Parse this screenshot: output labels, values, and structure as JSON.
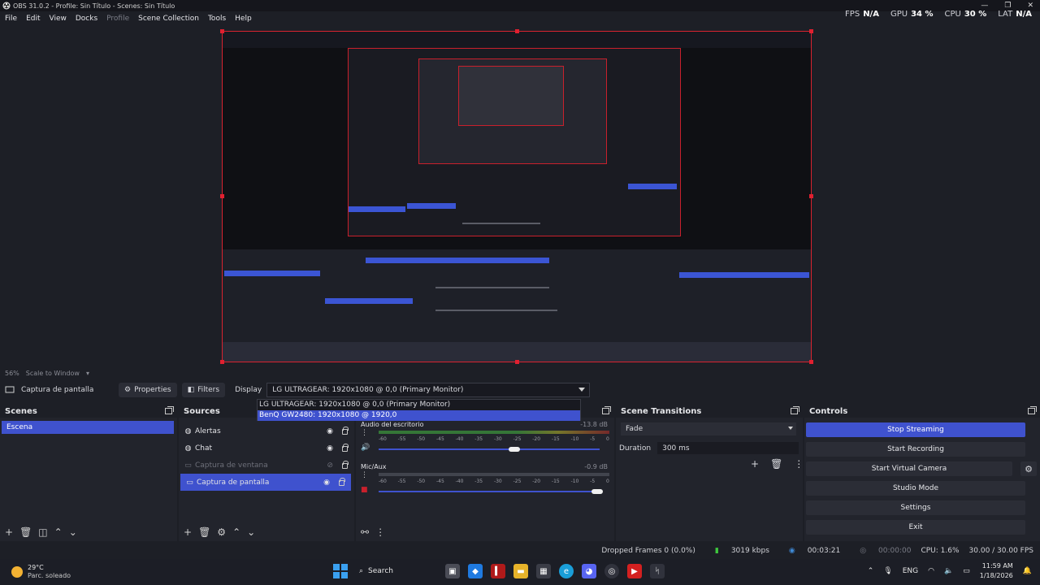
{
  "window": {
    "title": "OBS 31.0.2 - Profile: Sin Título - Scenes: Sin Título",
    "controls": [
      "—",
      "❐",
      "✕"
    ]
  },
  "menu": [
    "File",
    "Edit",
    "View",
    "Docks",
    "Profile",
    "Scene Collection",
    "Tools",
    "Help"
  ],
  "stats": {
    "fps_label": "FPS",
    "fps_value": "N/A",
    "gpu_label": "GPU",
    "gpu_value": "34 %",
    "cpu_label": "CPU",
    "cpu_value": "30 %",
    "lat_label": "LAT",
    "lat_value": "N/A"
  },
  "preview": {
    "zoom": "56%",
    "scale_mode": "Scale to Window"
  },
  "source_toolbar": {
    "source_name": "Captura de pantalla",
    "properties_label": "Properties",
    "filters_label": "Filters",
    "display_label": "Display",
    "display_value": "LG ULTRAGEAR: 1920x1080 @ 0,0 (Primary Monitor)"
  },
  "display_dropdown": {
    "options": [
      "LG ULTRAGEAR: 1920x1080 @ 0,0 (Primary Monitor)",
      "BenQ GW2480: 1920x1080 @ 1920,0"
    ],
    "highlighted_index": 1
  },
  "scenes": {
    "title": "Scenes",
    "items": [
      "Escena"
    ]
  },
  "sources": {
    "title": "Sources",
    "items": [
      {
        "name": "Alertas",
        "icon": "globe-icon"
      },
      {
        "name": "Chat",
        "icon": "globe-icon"
      },
      {
        "name": "Captura de ventana",
        "icon": "window-icon",
        "hidden": true
      },
      {
        "name": "Captura de pantalla",
        "icon": "monitor-icon",
        "selected": true
      }
    ]
  },
  "mixer": {
    "tracks": [
      {
        "name": "Audio del escritorio",
        "db": "-13.8 dB"
      },
      {
        "name": "Mic/Aux",
        "db": "-0.9 dB"
      }
    ],
    "ticks": [
      "-60",
      "-55",
      "-50",
      "-45",
      "-40",
      "-35",
      "-30",
      "-25",
      "-20",
      "-15",
      "-10",
      "-5",
      "0"
    ]
  },
  "transitions": {
    "title": "Scene Transitions",
    "selected": "Fade",
    "duration_label": "Duration",
    "duration_value": "300 ms"
  },
  "controls": {
    "title": "Controls",
    "buttons": [
      "Stop Streaming",
      "Start Recording",
      "Start Virtual Camera",
      "Studio Mode",
      "Settings",
      "Exit"
    ]
  },
  "status": {
    "dropped_frames": "Dropped Frames 0 (0.0%)",
    "bitrate": "3019 kbps",
    "stream_time": "00:03:21",
    "rec_time": "00:00:00",
    "cpu": "CPU: 1.6%",
    "fps": "30.00 / 30.00 FPS"
  },
  "taskbar": {
    "temp": "29°C",
    "condition": "Parc. soleado",
    "search": "Search",
    "lang": "ENG",
    "time": "11:59 AM",
    "date": "1/18/2026"
  },
  "colors": {
    "accent": "#3f52ce",
    "preview_border": "#d8232f",
    "panel": "#22242c"
  }
}
